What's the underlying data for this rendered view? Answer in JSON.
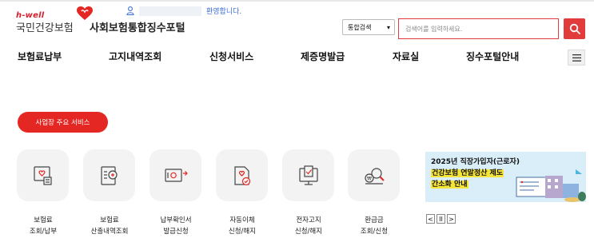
{
  "header": {
    "logo_hwell": "h-well",
    "logo_name": "국민건강보험",
    "site_title": "사회보험통합징수포털",
    "user_welcome": "환영합니다."
  },
  "search": {
    "select_value": "통합검색",
    "placeholder": "검색어를 입력하세요."
  },
  "nav": {
    "items": [
      "보험료납부",
      "고지내역조회",
      "신청서비스",
      "제증명발급",
      "자료실",
      "징수포털안내"
    ]
  },
  "services_button": "사업장 주요 서비스",
  "tiles": [
    {
      "icon": "heart-document-icon",
      "line1": "보험료",
      "line2": "조회/납부"
    },
    {
      "icon": "calculation-list-icon",
      "line1": "보험료",
      "line2": "산출내역조회"
    },
    {
      "icon": "payment-certificate-icon",
      "line1": "납부확인서",
      "line2": "발급신청"
    },
    {
      "icon": "auto-transfer-icon",
      "line1": "자동이체",
      "line2": "신청/해지"
    },
    {
      "icon": "e-notice-icon",
      "line1": "전자고지",
      "line2": "신청/해지"
    },
    {
      "icon": "refund-search-icon",
      "line1": "환급금",
      "line2": "조회/신청"
    }
  ],
  "banner": {
    "line1": "2025년 직장가입자(근로자)",
    "line2": "건강보험 연말정산 제도",
    "line3": "간소화 안내"
  },
  "slider_controls": {
    "prev": "<",
    "pause": "II",
    "next": ">"
  },
  "colors": {
    "accent": "#e42722",
    "banner_bg": "#d9eef9",
    "highlight": "#f5e43a"
  }
}
